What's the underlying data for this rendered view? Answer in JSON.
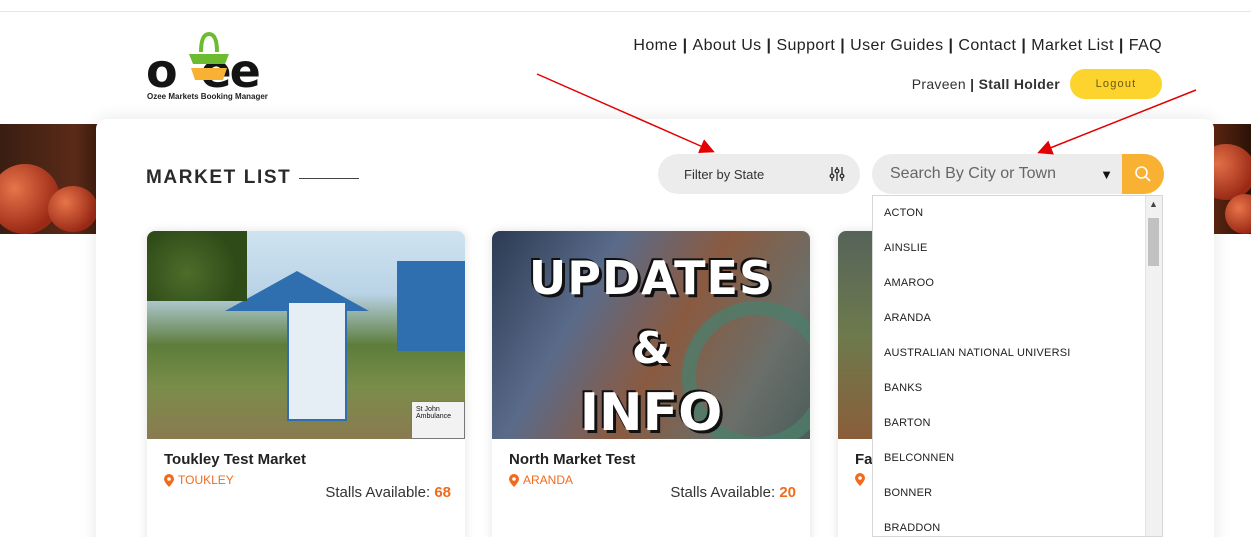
{
  "logo": {
    "text": "ozee",
    "tagline": "Ozee Markets Booking Manager"
  },
  "nav": {
    "items": [
      "Home",
      "About Us",
      "Support",
      "User Guides",
      "Contact",
      "Market List",
      "FAQ"
    ]
  },
  "user": {
    "name": "Praveen",
    "separator": "|",
    "role": "Stall Holder",
    "logout_label": "Logout"
  },
  "page": {
    "title": "MARKET LIST"
  },
  "filter": {
    "state_label": "Filter by State",
    "icon": "sliders-icon"
  },
  "search": {
    "placeholder": "Search By City or Town",
    "caret": "▼",
    "icon": "search-icon"
  },
  "markets": [
    {
      "name": "Toukley Test Market",
      "location": "TOUKLEY",
      "stalls_label": "Stalls Available:",
      "stalls": "68"
    },
    {
      "name": "North Market Test",
      "location": "ARANDA",
      "stalls_label": "Stalls Available:",
      "stalls": "20",
      "image_text": [
        "UPDATES",
        "&",
        "INFO"
      ]
    },
    {
      "name": "Fa",
      "location": "",
      "stalls_label": "",
      "stalls": ""
    }
  ],
  "city_options": [
    "ACTON",
    "AINSLIE",
    "AMAROO",
    "ARANDA",
    "AUSTRALIAN NATIONAL UNIVERSI",
    "BANKS",
    "BARTON",
    "BELCONNEN",
    "BONNER",
    "BRADDON"
  ],
  "colors": {
    "accent": "#f8b133",
    "orange_text": "#f26b1d",
    "logout": "#fdd32d",
    "arrow": "#e30000"
  }
}
